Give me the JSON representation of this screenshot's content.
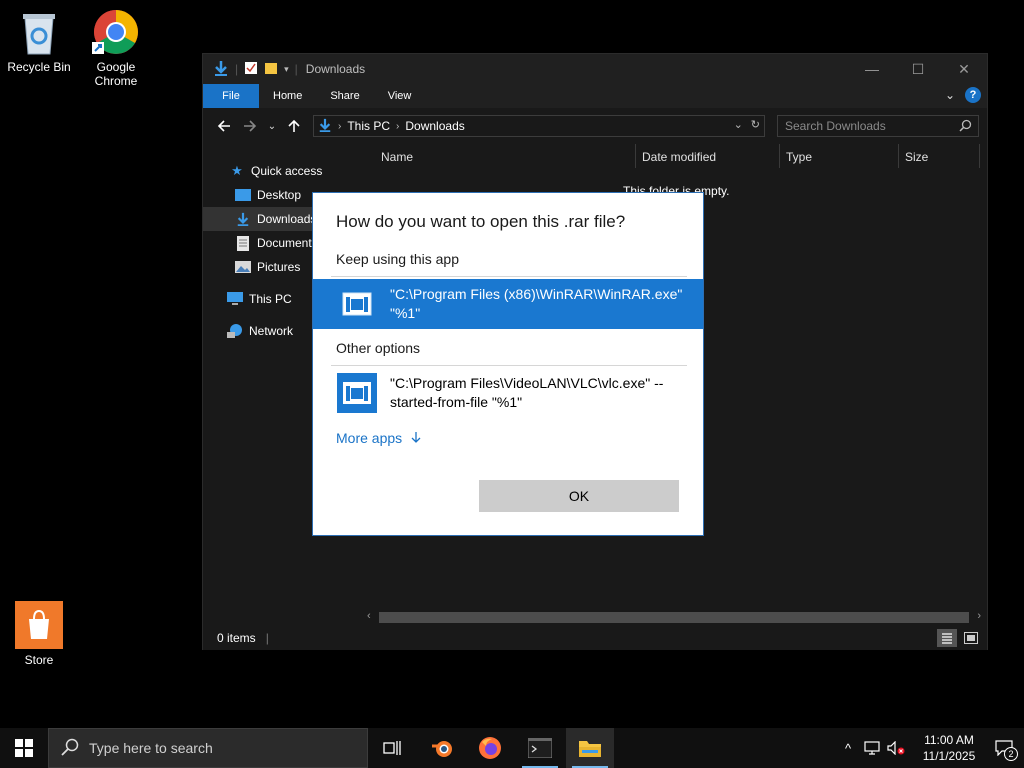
{
  "desktop": {
    "icons": [
      {
        "label": "Recycle Bin"
      },
      {
        "label": "Google Chrome"
      },
      {
        "label": "Store"
      }
    ]
  },
  "explorer": {
    "title": "Downloads",
    "ribbon_tabs": [
      "File",
      "Home",
      "Share",
      "View"
    ],
    "breadcrumb": [
      "This PC",
      "Downloads"
    ],
    "search_placeholder": "Search Downloads",
    "nav": [
      {
        "label": "Quick access"
      },
      {
        "label": "Desktop"
      },
      {
        "label": "Downloads"
      },
      {
        "label": "Documents"
      },
      {
        "label": "Pictures"
      },
      {
        "label": "This PC"
      },
      {
        "label": "Network"
      }
    ],
    "columns": [
      "Name",
      "Date modified",
      "Type",
      "Size"
    ],
    "empty_text": "This folder is empty.",
    "status": "0 items"
  },
  "dialog": {
    "title": "How do you want to open this .rar file?",
    "keep_label": "Keep using this app",
    "keep_app": "\"C:\\Program Files (x86)\\WinRAR\\WinRAR.exe\" \"%1\"",
    "other_label": "Other options",
    "other_app": "\"C:\\Program Files\\VideoLAN\\VLC\\vlc.exe\" --started-from-file \"%1\"",
    "more_apps": "More apps",
    "ok_label": "OK"
  },
  "taskbar": {
    "search_placeholder": "Type here to search",
    "time": "11:00 AM",
    "date": "11/1/2025",
    "notification_count": "2"
  },
  "colors": {
    "accent": "#1a78d0",
    "dark_bg": "#191919",
    "ok_button": "#cccccc"
  }
}
